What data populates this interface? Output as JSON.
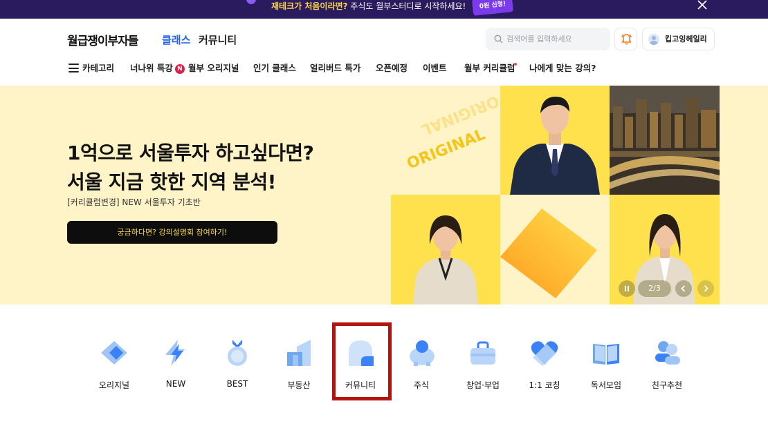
{
  "promo": {
    "highlight": "재테크가 처음이라면?",
    "text": "주식도 월부스터디로 시작하세요!",
    "badge": "0원 신청!"
  },
  "header": {
    "logo": "월급쟁이부자들",
    "nav": [
      {
        "label": "클래스",
        "active": true
      },
      {
        "label": "커뮤니티",
        "active": false
      }
    ],
    "search_placeholder": "검색어를 입력하세요",
    "user_name": "킵고잉헤일리"
  },
  "category_nav": {
    "menu_label": "카테고리",
    "items": [
      {
        "label": "너나위 특강",
        "badge": "N"
      },
      {
        "label": "월부 오리지널"
      },
      {
        "label": "인기 클래스"
      },
      {
        "label": "얼리버드 특가"
      },
      {
        "label": "오픈예정"
      },
      {
        "label": "이벤트"
      },
      {
        "label": "월부 커리큘럼",
        "dot": true
      },
      {
        "label": "나에게 맞는 강의?"
      }
    ]
  },
  "hero": {
    "title_line1": "1억으로 서울투자 하고싶다면?",
    "title_line2": "서울 지금 핫한 지역 분석!",
    "subtitle": "[커리큘럼변경] NEW 서울투자 기초반",
    "cta": "궁금하다면? 강의설명회 참여하기!",
    "deco_text": "ORIGINAL",
    "pager": "2/3"
  },
  "quick_menu": [
    {
      "label": "오리지널",
      "icon": "original-icon"
    },
    {
      "label": "NEW",
      "icon": "lightning-icon"
    },
    {
      "label": "BEST",
      "icon": "medal-icon"
    },
    {
      "label": "부동산",
      "icon": "building-icon"
    },
    {
      "label": "커뮤니티",
      "icon": "community-icon"
    },
    {
      "label": "주식",
      "icon": "piggy-bank-icon"
    },
    {
      "label": "창업·부업",
      "icon": "briefcase-icon"
    },
    {
      "label": "1:1 코칭",
      "icon": "heart-icon"
    },
    {
      "label": "독서모임",
      "icon": "book-icon"
    },
    {
      "label": "친구추천",
      "icon": "friends-icon"
    }
  ],
  "colors": {
    "accent": "#2563eb",
    "promo_bg": "#2a1a5e",
    "hero_bg": "#fff3c8",
    "highlight_box": "#b3130d"
  }
}
